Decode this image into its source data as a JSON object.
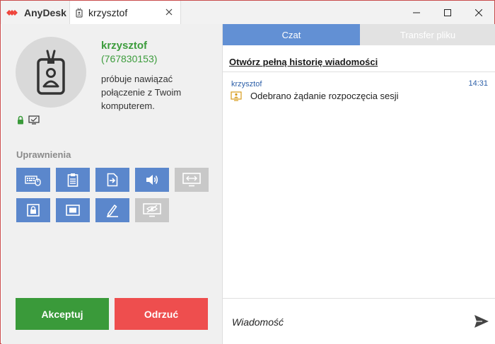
{
  "titlebar": {
    "app_name": "AnyDesk",
    "session_tab_label": "krzysztof"
  },
  "session": {
    "user_name": "krzysztof",
    "user_id": "(767830153)",
    "message": "próbuje nawiązać połączenie z Twoim komputerem."
  },
  "permissions": {
    "title": "Uprawnienia",
    "buttons": [
      {
        "icon": "keyboard-mouse-icon",
        "enabled": true
      },
      {
        "icon": "clipboard-icon",
        "enabled": true
      },
      {
        "icon": "file-transfer-icon",
        "enabled": true
      },
      {
        "icon": "sound-icon",
        "enabled": true
      },
      {
        "icon": "control-screen-icon",
        "enabled": false
      },
      {
        "icon": "lock-screen-icon",
        "enabled": true
      },
      {
        "icon": "record-session-icon",
        "enabled": true
      },
      {
        "icon": "draw-icon",
        "enabled": true
      },
      {
        "icon": "privacy-mode-icon",
        "enabled": false
      }
    ]
  },
  "actions": {
    "accept_label": "Akceptuj",
    "reject_label": "Odrzuć"
  },
  "tabs": {
    "chat": "Czat",
    "file_transfer": "Transfer pliku"
  },
  "chat": {
    "history_link": "Otwórz pełną historię wiadomości",
    "messages": [
      {
        "sender": "krzysztof",
        "time": "14:31",
        "text": "Odebrano żądanie rozpoczęcia sesji"
      }
    ],
    "input_placeholder": "Wiadomość"
  },
  "colors": {
    "accent_red": "#ef443b",
    "green": "#3a9a3a",
    "blue": "#5b87cc",
    "reject_red": "#ee4e4e"
  }
}
